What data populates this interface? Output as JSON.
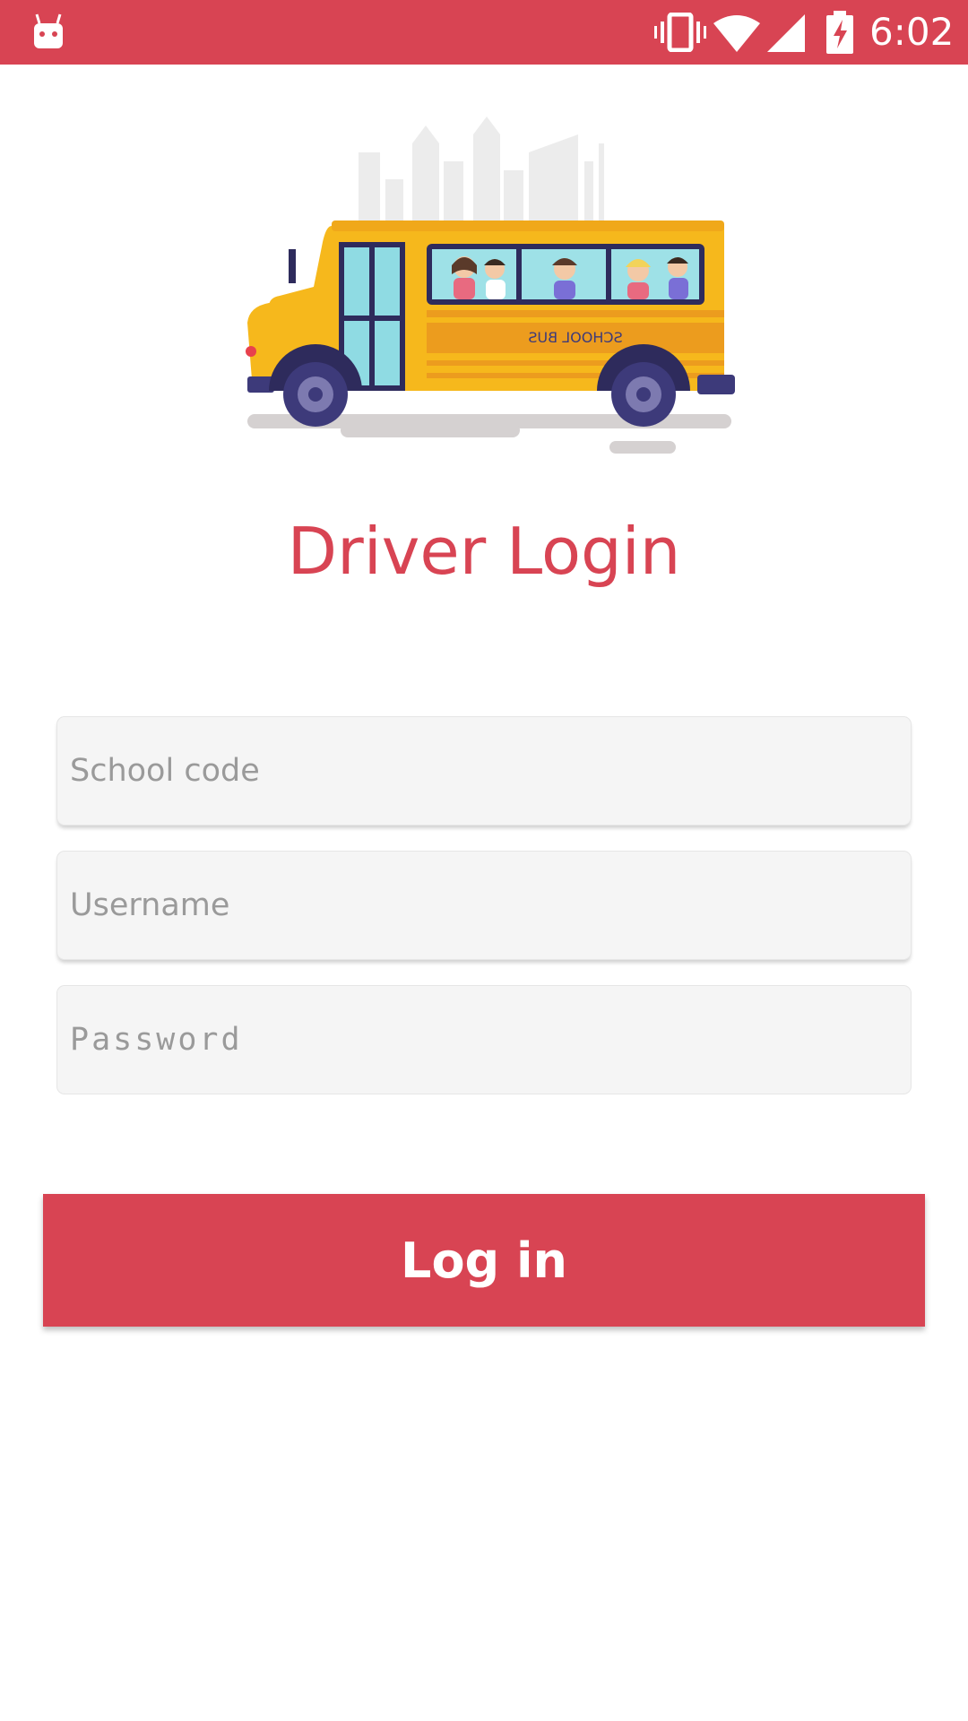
{
  "status_bar": {
    "time": "6:02",
    "icons": [
      "android-icon",
      "vibrate-icon",
      "wifi-icon",
      "signal-icon",
      "battery-charging-icon"
    ]
  },
  "hero": {
    "image": "school-bus-illustration",
    "bus_text": "SCHOOL BUS"
  },
  "title": "Driver Login",
  "form": {
    "school_code_placeholder": "School code",
    "username_placeholder": "Username",
    "password_placeholder": "Password"
  },
  "login_button_label": "Log in",
  "colors": {
    "accent": "#d84453",
    "field_bg": "#f5f5f5",
    "placeholder": "#9a9a9a"
  }
}
